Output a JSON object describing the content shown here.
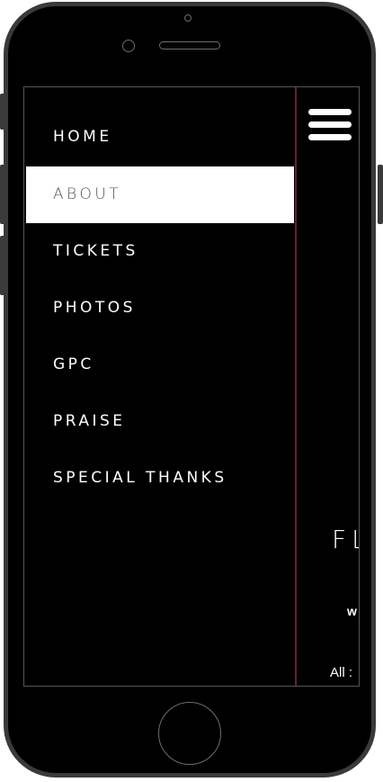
{
  "menu": {
    "items": [
      {
        "label": "HOME",
        "active": false
      },
      {
        "label": "ABOUT",
        "active": true
      },
      {
        "label": "TICKETS",
        "active": false
      },
      {
        "label": "PHOTOS",
        "active": false
      },
      {
        "label": "GPC",
        "active": false
      },
      {
        "label": "PRAISE",
        "active": false
      },
      {
        "label": "SPECIAL THANKS",
        "active": false
      }
    ]
  },
  "peek": {
    "title_fragment": "FL",
    "w_fragment": "w",
    "all_fragment": "All :"
  },
  "colors": {
    "background": "#000000",
    "active_bg": "#ffffff",
    "active_text": "#555555",
    "divider": "#6b1f35",
    "phone_frame": "#3a3a3a"
  },
  "icons": {
    "hamburger": "hamburger-menu-icon"
  }
}
